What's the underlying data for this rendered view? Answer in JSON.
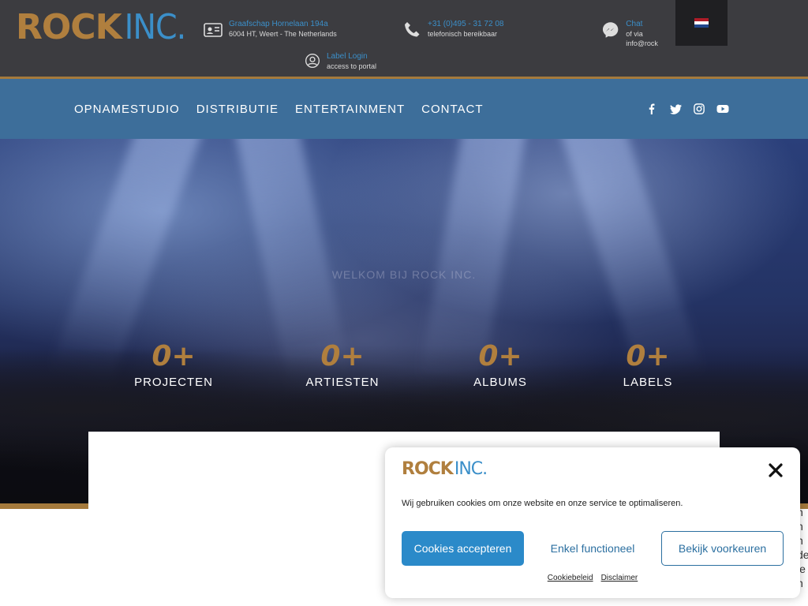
{
  "brand": {
    "rock": "ROCK",
    "inc": "INC."
  },
  "header": {
    "address": {
      "line1": "Graafschap Hornelaan 194a",
      "line2": "6004 HT, Weert - The Netherlands",
      "icon": "contact-card-icon"
    },
    "phone": {
      "line1": "+31 (0)495 - 31 72 08",
      "line2": "telefonisch bereikbaar",
      "icon": "phone-icon"
    },
    "chat": {
      "line1": "Chat",
      "line2": "of via info@rock",
      "icon": "messenger-icon"
    },
    "login": {
      "line1": "Label Login",
      "line2": "access to portal",
      "icon": "user-circle-icon"
    },
    "language": {
      "icon": "dutch-flag-icon"
    }
  },
  "nav": {
    "items": [
      {
        "label": "OPNAMESTUDIO"
      },
      {
        "label": "DISTRIBUTIE"
      },
      {
        "label": "ENTERTAINMENT"
      },
      {
        "label": "CONTACT"
      }
    ],
    "social": [
      "facebook-icon",
      "twitter-icon",
      "instagram-icon",
      "youtube-icon"
    ]
  },
  "hero": {
    "welcome": "WELKOM BIJ ROCK INC.",
    "stats": [
      {
        "value": "0+",
        "label": "PROJECTEN"
      },
      {
        "value": "0+",
        "label": "ARTIESTEN"
      },
      {
        "value": "0+",
        "label": "ALBUMS"
      },
      {
        "value": "0+",
        "label": "LABELS"
      }
    ]
  },
  "edge_text": [
    "n",
    "h",
    "n",
    "de",
    "ie",
    "n"
  ],
  "cookie": {
    "message": "Wij gebruiken cookies om onze website en onze service te optimaliseren.",
    "accept_label": "Cookies accepteren",
    "functional_label": "Enkel functioneel",
    "preferences_label": "Bekijk voorkeuren",
    "links": [
      "Cookiebeleid",
      "Disclaimer"
    ]
  },
  "colors": {
    "brand_gold": "#b07f3e",
    "brand_blue": "#3b8fc9",
    "nav_bg": "#3d6e9a",
    "topbar_bg": "#3c3c40"
  }
}
